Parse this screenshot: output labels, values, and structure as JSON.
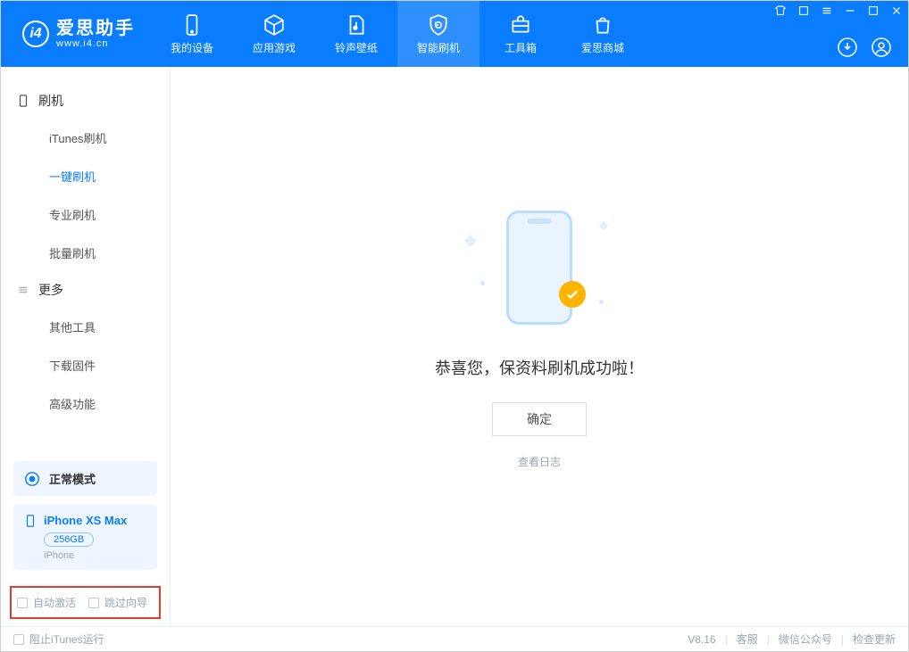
{
  "brand": {
    "zh": "爱思助手",
    "en": "www.i4.cn"
  },
  "tabs": {
    "device": "我的设备",
    "apps": "应用游戏",
    "ring": "铃声壁纸",
    "flash": "智能刷机",
    "toolbox": "工具箱",
    "mall": "爱思商城"
  },
  "sidebar": {
    "flash_heading": "刷机",
    "items": {
      "itunes": "iTunes刷机",
      "oneclick": "一键刷机",
      "pro": "专业刷机",
      "batch": "批量刷机"
    },
    "more_heading": "更多",
    "more": {
      "tools": "其他工具",
      "firmware": "下载固件",
      "advanced": "高级功能"
    }
  },
  "device": {
    "mode": "正常模式",
    "name": "iPhone XS Max",
    "capacity": "256GB",
    "type": "iPhone"
  },
  "checks": {
    "auto_activate": "自动激活",
    "skip_guide": "跳过向导"
  },
  "main": {
    "success": "恭喜您，保资料刷机成功啦！",
    "ok": "确定",
    "view_log": "查看日志"
  },
  "status": {
    "block_itunes": "阻止iTunes运行",
    "version": "V8.16",
    "support": "客服",
    "wechat": "微信公众号",
    "update": "检查更新"
  }
}
